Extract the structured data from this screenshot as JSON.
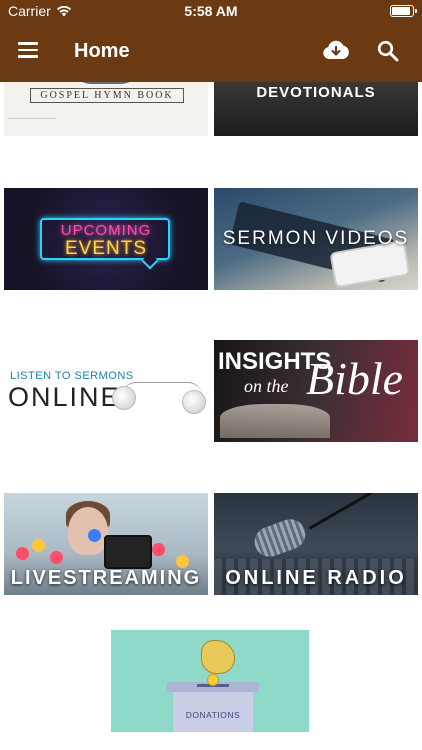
{
  "status_bar": {
    "carrier": "Carrier",
    "time": "5:58 AM"
  },
  "header": {
    "title": "Home",
    "menu_icon": "hamburger-menu-icon",
    "download_icon": "cloud-download-icon",
    "search_icon": "search-icon",
    "background_color": "#6b3a12"
  },
  "tiles": {
    "hymn_book": {
      "label": "GOSPEL HYMN BOOK"
    },
    "devotionals": {
      "label": "DEVOTIONALS"
    },
    "events": {
      "line1": "UPCOMING",
      "line2": "EVENTS"
    },
    "videos": {
      "label": "SERMON VIDEOS"
    },
    "listen": {
      "line1": "LISTEN TO SERMONS",
      "line2": "ONLINE"
    },
    "insights": {
      "word1": "INSIGHTS",
      "word2": "on the",
      "word3": "Bible"
    },
    "livestreaming": {
      "label": "LIVESTREAMING"
    },
    "radio": {
      "label": "ONLINE RADIO"
    },
    "donations": {
      "label": "DONATIONS"
    }
  }
}
